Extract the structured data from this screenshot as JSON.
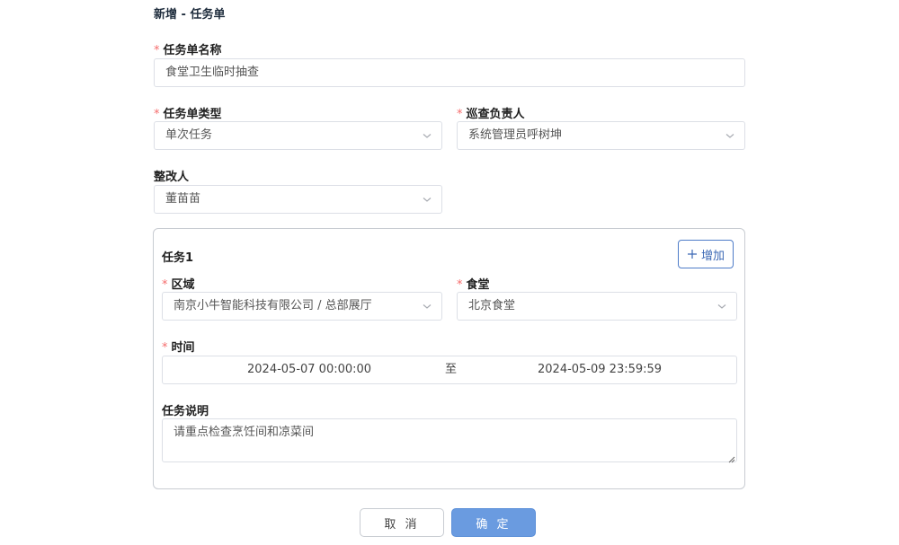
{
  "page": {
    "title": "新增 - 任务单"
  },
  "form": {
    "name": {
      "label": "任务单名称",
      "value": "食堂卫生临时抽查"
    },
    "type": {
      "label": "任务单类型",
      "value": "单次任务"
    },
    "inspector": {
      "label": "巡查负责人",
      "value": "系统管理员呼树坤"
    },
    "rectifier": {
      "label": "整改人",
      "value": "董苗苗"
    }
  },
  "task": {
    "title": "任务1",
    "add_label": "增加",
    "area": {
      "label": "区域",
      "value": "南京小牛智能科技有限公司 / 总部展厅"
    },
    "canteen": {
      "label": "食堂",
      "value": "北京食堂"
    },
    "time": {
      "label": "时间",
      "start": "2024-05-07 00:00:00",
      "separator": "至",
      "end": "2024-05-09 23:59:59"
    },
    "description": {
      "label": "任务说明",
      "value": "请重点检查烹饪间和凉菜间"
    }
  },
  "buttons": {
    "cancel": "取 消",
    "ok": "确 定"
  },
  "colors": {
    "required": "#f56c6c",
    "primary": "#6a9be0",
    "border": "#dcdfe6"
  },
  "icons": {
    "select": "chevron-down-icon",
    "add": "plus-icon",
    "resize": "resize-grip-icon"
  }
}
